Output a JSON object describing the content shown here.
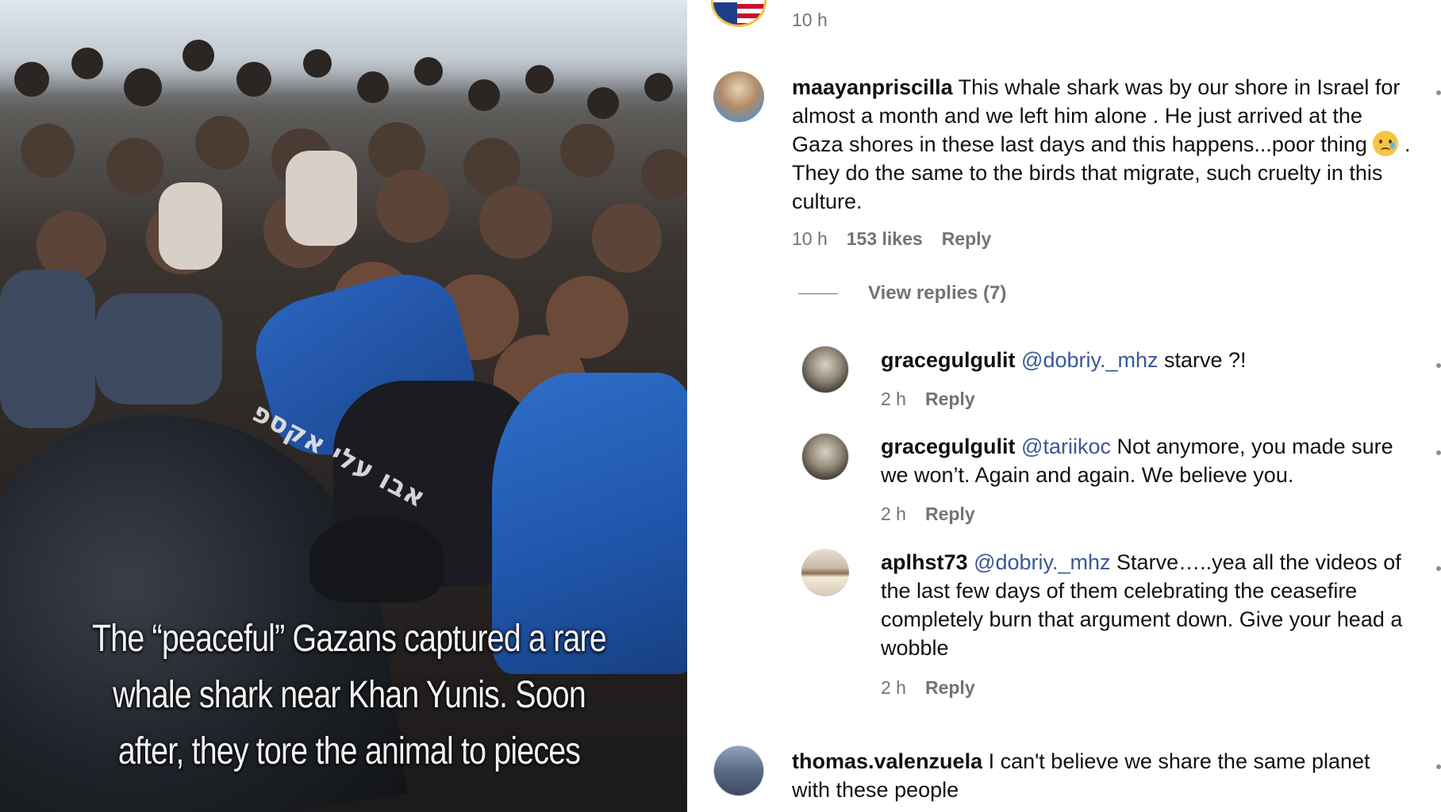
{
  "video": {
    "caption": "The “peaceful” Gazans captured a rare whale shark near Khan Yunis. Soon after, they tore the animal to pieces",
    "shirt_text": "אבו עלי אקספ"
  },
  "comments": {
    "top_partial": {
      "time": "10 h"
    },
    "main": {
      "username": "maayanpriscilla",
      "text_part1": "This whale shark was by our shore in Israel for almost a month and we left him alone . He just arrived at the Gaza shores in these last days and this happens...poor thing",
      "emoji": "crying-face",
      "text_part2": ". They do the same to the birds that migrate, such cruelty in this culture.",
      "time": "10 h",
      "likes": "153 likes",
      "reply": "Reply"
    },
    "view_replies": "View replies (7)",
    "replies": [
      {
        "username": "gracegulgulit",
        "mention": "@dobriy._mhz",
        "text": "starve ?!",
        "time": "2 h",
        "reply": "Reply"
      },
      {
        "username": "gracegulgulit",
        "mention": "@tariikoc",
        "text": "Not anymore, you made sure we won’t. Again and again. We believe you.",
        "time": "2 h",
        "reply": "Reply"
      },
      {
        "username": "aplhst73",
        "mention": "@dobriy._mhz",
        "text": "Starve…..yea all the videos of the last few days of them celebrating the ceasefire completely burn that argument down. Give your head a wobble",
        "time": "2 h",
        "reply": "Reply"
      }
    ],
    "last": {
      "username": "thomas.valenzuela",
      "text": "I can't believe we share the same planet with these people"
    }
  }
}
